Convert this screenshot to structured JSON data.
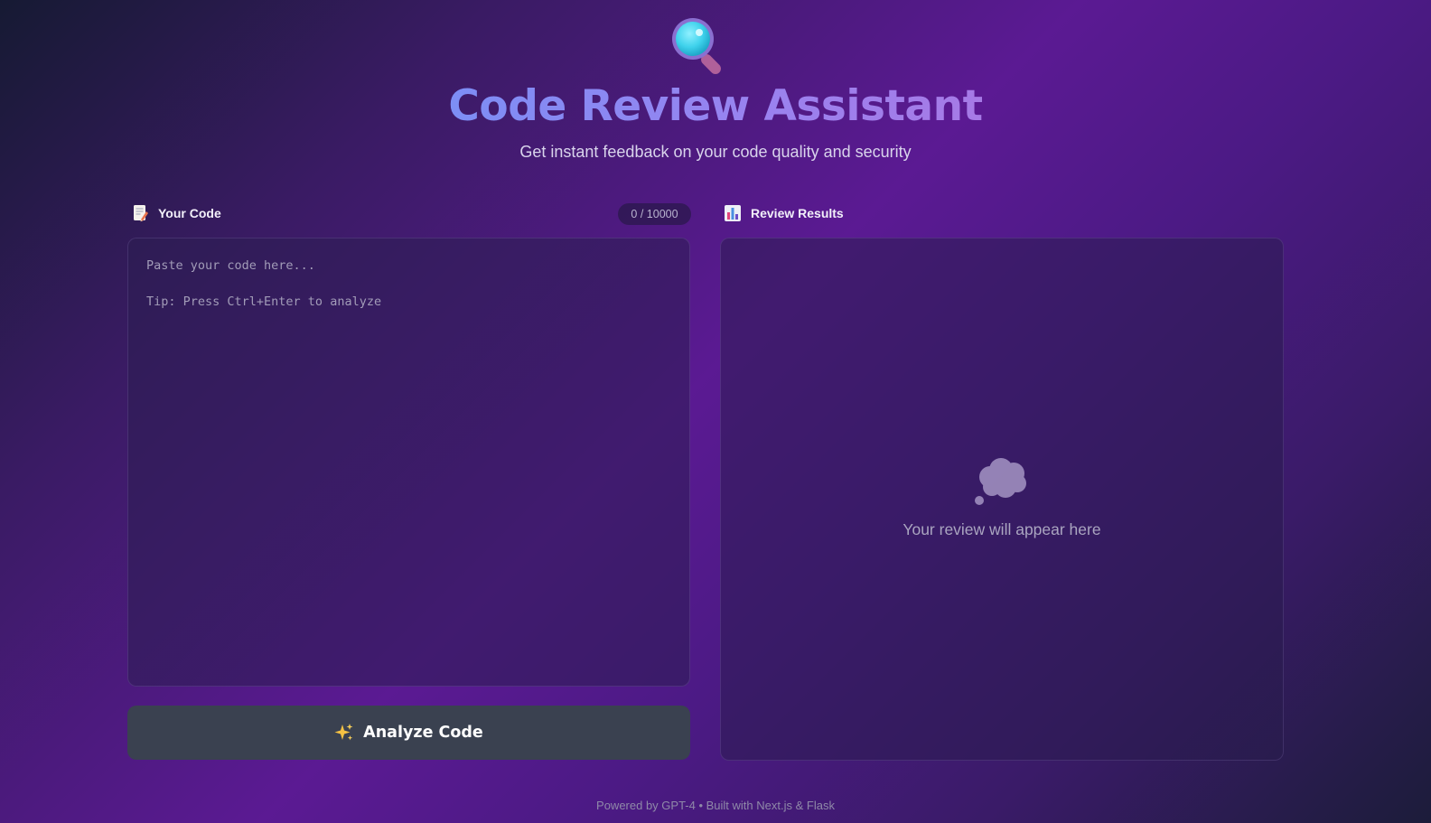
{
  "header": {
    "logo_icon": "magnifying-glass-icon",
    "title": "Code Review Assistant",
    "subtitle": "Get instant feedback on your code quality and security"
  },
  "code_panel": {
    "icon": "memo-icon",
    "label": "Your Code",
    "char_count": "0 / 10000",
    "placeholder": "Paste your code here...\n\nTip: Press Ctrl+Enter to analyze",
    "value": ""
  },
  "results_panel": {
    "icon": "bar-chart-icon",
    "label": "Review Results",
    "empty_icon": "thought-bubble-icon",
    "empty_text": "Your review will appear here"
  },
  "analyze_button": {
    "icon": "sparkles-icon",
    "label": "Analyze Code"
  },
  "footer": {
    "text": "Powered by GPT-4 • Built with Next.js & Flask"
  },
  "colors": {
    "title_start": "#7d8ef5",
    "title_end": "#a67ae6",
    "button_bg": "#3a4150",
    "background_accent": "#5b1a93"
  }
}
